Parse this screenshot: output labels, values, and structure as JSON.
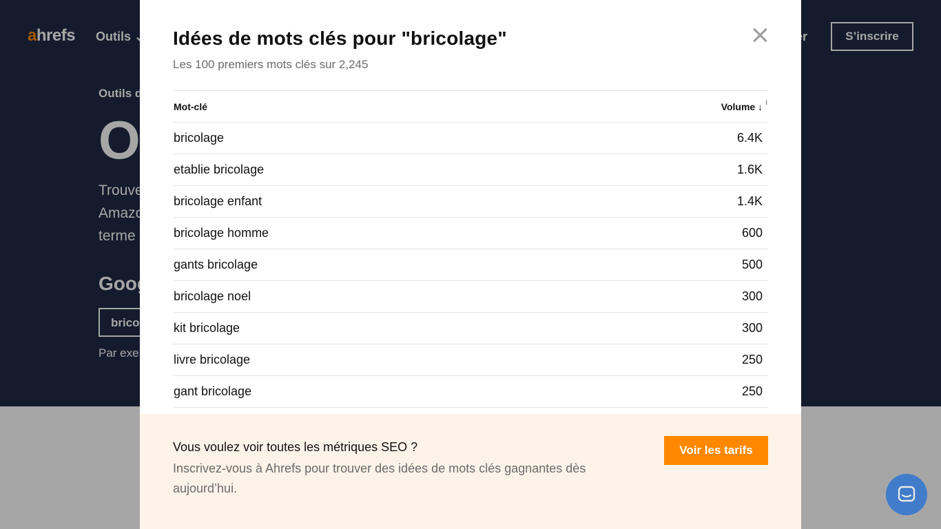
{
  "background": {
    "logo_accent": "a",
    "logo_rest": "hrefs",
    "nav_tools": "Outils ⌄",
    "nav_login": "er",
    "signup": "S’inscrire",
    "crumb": "Outils d",
    "big_title": "O",
    "desc": "Trouve Amazo terme",
    "google": "Goog",
    "input_value": "brico",
    "example": "Par exe"
  },
  "modal": {
    "title": "Idées de mots clés pour \"bricolage\"",
    "subtitle": "Les 100 premiers mots clés sur 2,245",
    "table": {
      "col_keyword": "Mot-clé",
      "col_volume": "Volume",
      "sort_icon": "↓",
      "info_icon": "i",
      "rows": [
        {
          "keyword": "bricolage",
          "volume": "6.4K"
        },
        {
          "keyword": "etablie bricolage",
          "volume": "1.6K"
        },
        {
          "keyword": "bricolage enfant",
          "volume": "1.4K"
        },
        {
          "keyword": "bricolage homme",
          "volume": "600"
        },
        {
          "keyword": "gants bricolage",
          "volume": "500"
        },
        {
          "keyword": "bricolage noel",
          "volume": "300"
        },
        {
          "keyword": "kit bricolage",
          "volume": "300"
        },
        {
          "keyword": "livre bricolage",
          "volume": "250"
        },
        {
          "keyword": "gant bricolage",
          "volume": "250"
        }
      ]
    },
    "footer": {
      "title": "Vous voulez voir toutes les métriques SEO ?",
      "desc": "Inscrivez-vous à Ahrefs pour trouver des idées de mots clés gagnantes dès aujourd’hui.",
      "button": "Voir les tarifs"
    }
  },
  "colors": {
    "accent": "#ff8800",
    "navy": "#1f2a44",
    "footer_bg": "#fdf3e8"
  },
  "icons": {
    "close": "close-icon",
    "chat": "chat-icon"
  }
}
